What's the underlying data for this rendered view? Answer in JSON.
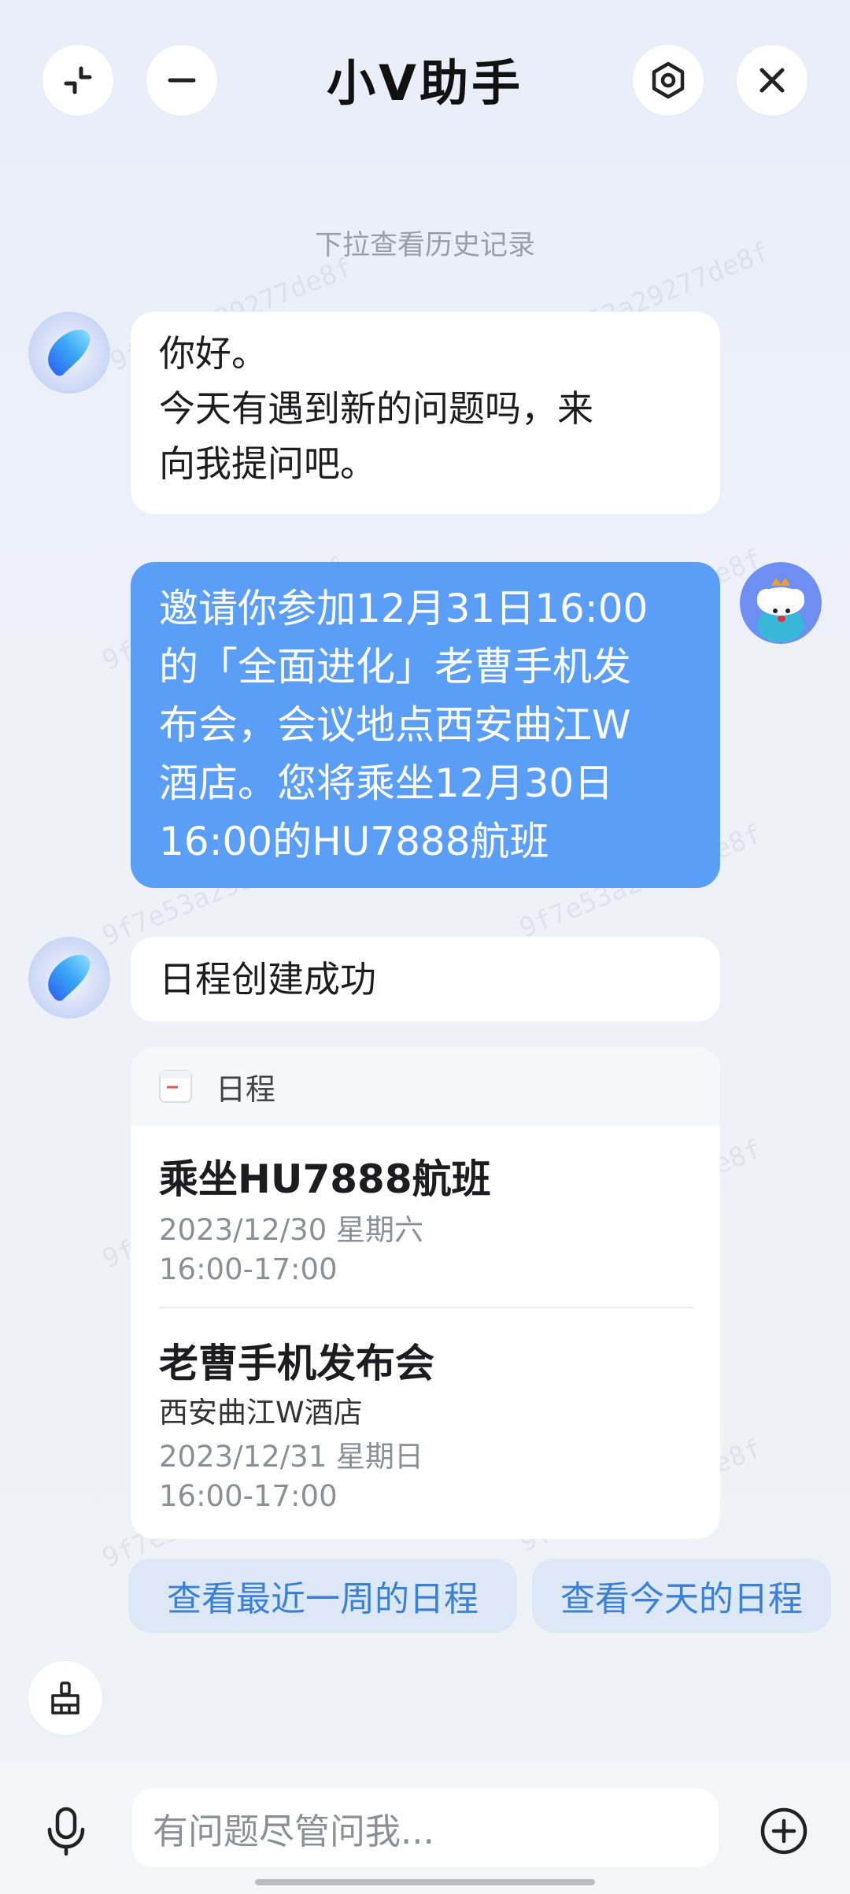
{
  "header": {
    "title": "小V助手",
    "collapse_icon": "collapse-icon",
    "minimize_icon": "minimize-icon",
    "settings_icon": "hexagon-settings-icon",
    "close_icon": "close-icon"
  },
  "history_hint": "下拉查看历史记录",
  "watermark": "9f7e53a29277de8f",
  "messages": {
    "greeting": "你好。\n今天有遇到新的问题吗，来\n向我提问吧。",
    "user": "邀请你参加12月31日16:00\n的「全面进化」老曹手机发\n布会，会议地点西安曲江W\n酒店。您将乘坐12月30日\n16:00的HU7888航班",
    "reply": "日程创建成功"
  },
  "schedule_card": {
    "header_label": "日程",
    "events": [
      {
        "title": "乘坐HU7888航班",
        "location": "",
        "date": "2023/12/30  星期六",
        "time": "16:00-17:00"
      },
      {
        "title": "老曹手机发布会",
        "location": "西安曲江W酒店",
        "date": "2023/12/31  星期日",
        "time": "16:00-17:00"
      }
    ]
  },
  "suggestions": [
    "查看最近一周的日程",
    "查看今天的日程"
  ],
  "input": {
    "placeholder": "有问题尽管问我..."
  },
  "colors": {
    "user_bubble": "#5a9ef7",
    "chip_bg": "#dde8f7",
    "chip_text": "#3b7fd6"
  }
}
